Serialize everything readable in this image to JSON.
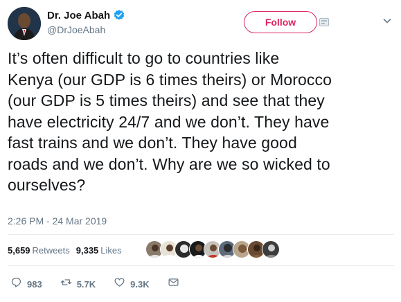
{
  "author": {
    "name": "Dr. Joe Abah",
    "handle": "@DrJoeAbah",
    "verified": true
  },
  "follow_button": {
    "label": "Follow"
  },
  "tweet": {
    "lines": [
      "It’s often difficult to go to countries like",
      "Kenya (our GDP is 6 times theirs) or Morocco",
      "(our GDP is 5 times theirs) and see that they",
      "have electricity 24/7 and we don’t. They have",
      "fast trains and we don’t. They have good",
      "roads and we don’t. Why are we so wicked to",
      "ourselves?"
    ],
    "timestamp": "2:26 PM - 24 Mar 2019"
  },
  "stats": {
    "retweets_count": "5,659",
    "retweets_label": "Retweets",
    "likes_count": "9,335",
    "likes_label": "Likes"
  },
  "likers": [
    {
      "color": "#8a7a6a"
    },
    {
      "color": "#e8e2d6"
    },
    {
      "color": "#2b2b2b"
    },
    {
      "color": "#1a1a1a"
    },
    {
      "color": "#c7c2bb"
    },
    {
      "color": "#5d6b7a"
    },
    {
      "color": "#b9a58c"
    },
    {
      "color": "#6b4a32"
    },
    {
      "color": "#3c3c3c"
    }
  ],
  "actions": {
    "reply_count": "983",
    "retweet_count": "5.7K",
    "like_count": "9.3K"
  },
  "colors": {
    "follow_accent": "#e0245e",
    "verified_blue": "#1da1f2",
    "muted_text": "#657786",
    "action_icon": "#657786"
  }
}
